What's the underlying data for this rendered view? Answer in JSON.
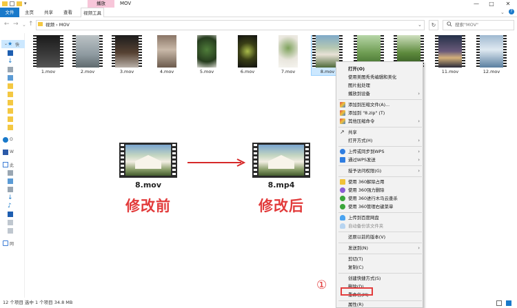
{
  "window": {
    "context_tab": "播放",
    "title": "MOV",
    "controls": [
      "—",
      "□",
      "✕"
    ],
    "ribbon_tabs": [
      "文件",
      "主页",
      "共享",
      "查看",
      "视频工具"
    ]
  },
  "address": {
    "path": "视频 › MOV",
    "search_placeholder": "搜索\"MOV\""
  },
  "sidebar": {
    "items": [
      "快",
      "O",
      "W",
      "此",
      "网"
    ]
  },
  "files": [
    {
      "name": "1.mov",
      "thumb": "dark-keyboard"
    },
    {
      "name": "2.mov",
      "thumb": "gray-room"
    },
    {
      "name": "3.mov",
      "thumb": "dark-hands"
    },
    {
      "name": "4.mov",
      "thumb": "coffee-shop"
    },
    {
      "name": "5.mov",
      "thumb": "plant-window"
    },
    {
      "name": "6.mov",
      "thumb": "dark-drink"
    },
    {
      "name": "7.mov",
      "thumb": "white-plant"
    },
    {
      "name": "8.mov",
      "thumb": "tent-forest"
    },
    {
      "name": "9.mov",
      "thumb": "green-field"
    },
    {
      "name": "10.mov",
      "thumb": "green-trees"
    },
    {
      "name": "11.mov",
      "thumb": "evening-scene"
    },
    {
      "name": "12.mov",
      "thumb": "blue-room"
    }
  ],
  "illustration": {
    "before_name": "8.mov",
    "after_name": "8.mp4",
    "before_label": "修改前",
    "after_label": "修改后"
  },
  "context_menu": {
    "items": [
      {
        "label": "打开(O)",
        "bold": true
      },
      {
        "label": "使用美图秀秀编辑和美化"
      },
      {
        "label": "图片批处理"
      },
      {
        "label": "播放到设备",
        "submenu": true
      },
      {
        "label": "添加到压缩文件(A)..."
      },
      {
        "label": "添加到 \"8.zip\" (T)"
      },
      {
        "label": "其他压缩命令",
        "submenu": true
      },
      {
        "label": "共享"
      },
      {
        "label": "打开方式(H)",
        "submenu": true
      },
      {
        "label": "上传或同步到WPS",
        "submenu": true
      },
      {
        "label": "通过WPS发送",
        "submenu": true
      },
      {
        "label": "授予访问权限(G)",
        "submenu": true
      },
      {
        "label": "使用 360解除占用"
      },
      {
        "label": "使用 360强力删除"
      },
      {
        "label": "使用 360进行木马云查杀"
      },
      {
        "label": "使用 360管理右键菜单"
      },
      {
        "label": "上传到百度网盘"
      },
      {
        "label": "自动备份该文件夹",
        "disabled": true
      },
      {
        "label": "还原以前的版本(V)"
      },
      {
        "label": "发送到(N)",
        "submenu": true
      },
      {
        "label": "剪切(T)"
      },
      {
        "label": "复制(C)"
      },
      {
        "label": "创建快捷方式(S)"
      },
      {
        "label": "删除(D)"
      },
      {
        "label": "重命名(M)"
      },
      {
        "label": "属性(R)"
      }
    ]
  },
  "annotation": {
    "step_marker": "①"
  },
  "status": {
    "text": "12 个项目    选中 1 个项目  34.8 MB"
  },
  "colors": {
    "accent": "#1979ca",
    "annotation_red": "#e23b3b",
    "context_tab": "#f7c6d9",
    "selection": "#cce8ff"
  }
}
